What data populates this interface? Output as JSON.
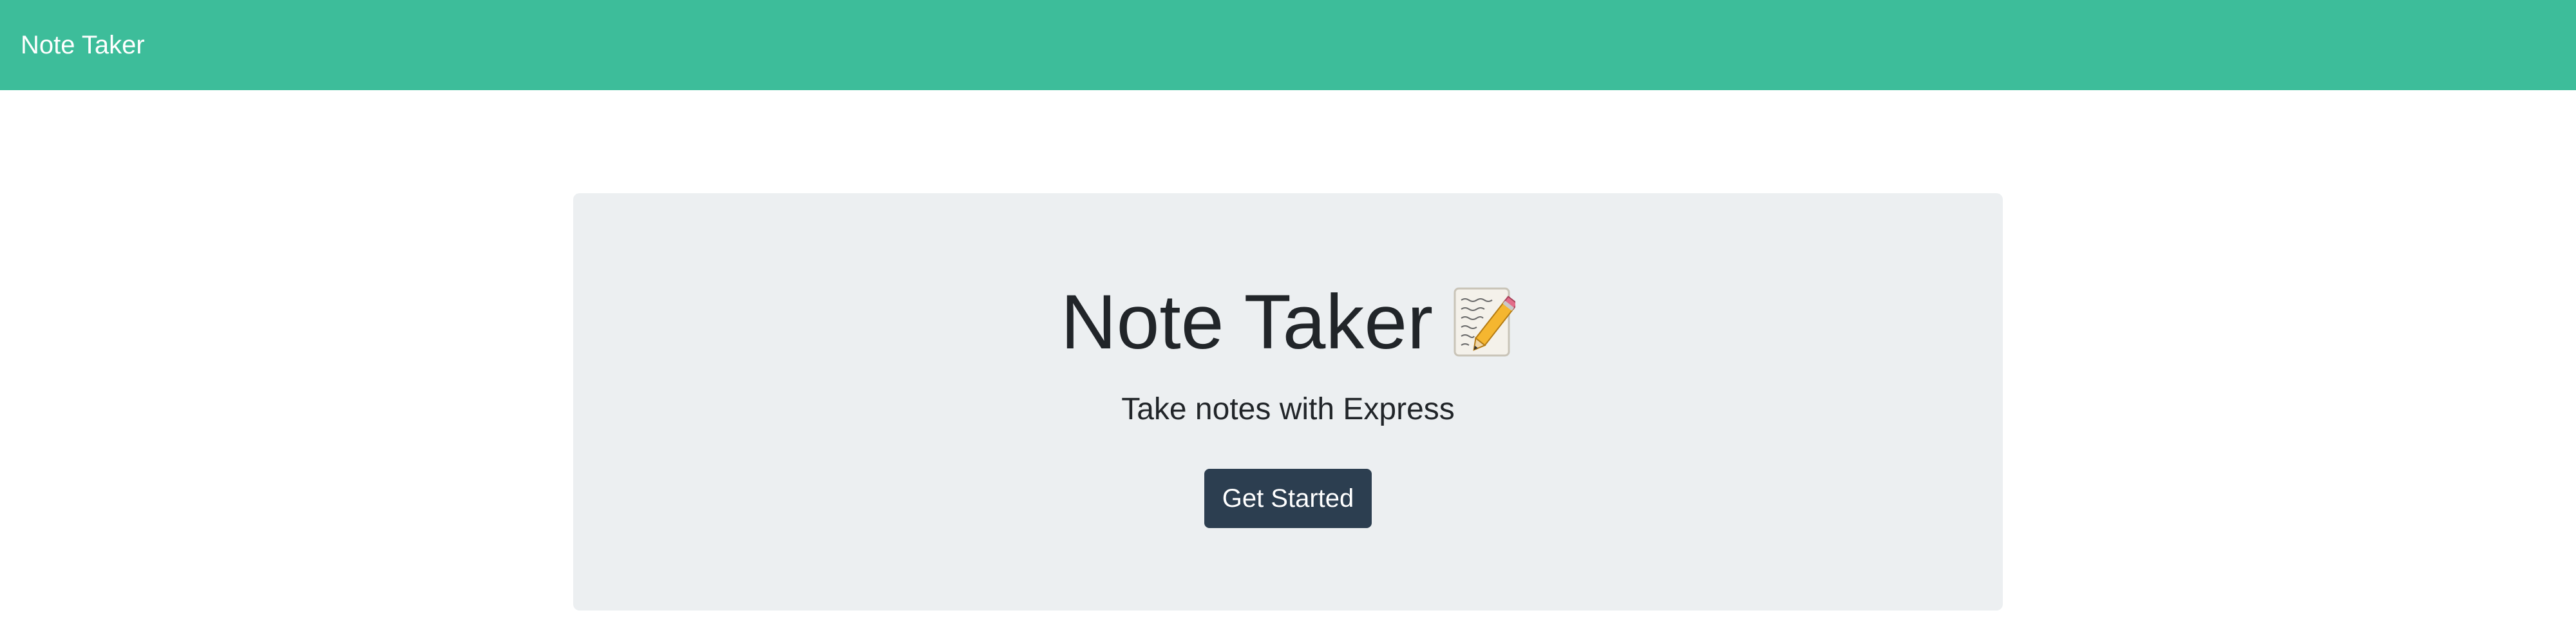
{
  "navbar": {
    "brand": "Note Taker"
  },
  "hero": {
    "title": "Note Taker",
    "title_icon": "memo-pencil-icon",
    "subtitle": "Take notes with Express",
    "cta_label": "Get Started"
  },
  "colors": {
    "navbar_bg": "#3dbd9a",
    "jumbotron_bg": "#eceff1",
    "button_bg": "#2c3e50",
    "text": "#212529"
  }
}
